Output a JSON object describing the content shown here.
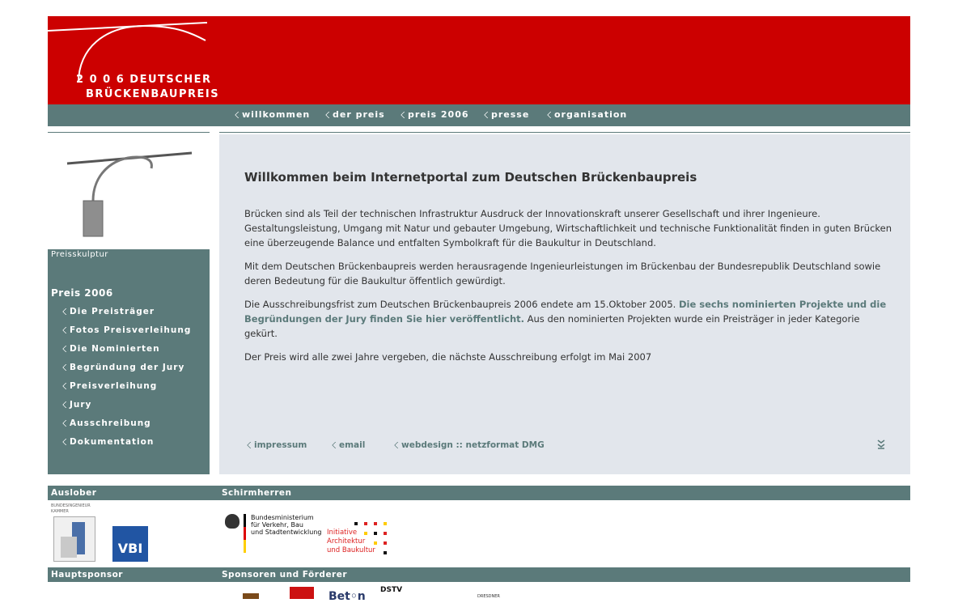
{
  "header": {
    "logo_line1": "2 0 0 6 DEUTSCHER",
    "logo_line2": "BRÜCKENBAUPREIS"
  },
  "nav": {
    "items": [
      "willkommen",
      "der preis",
      "preis 2006",
      "presse",
      "organisation"
    ]
  },
  "sidebar": {
    "caption": "Preisskulptur",
    "section_title": "Preis 2006",
    "items": [
      "Die Preisträger",
      "Fotos Preisverleihung",
      "Die Nominierten",
      "Begründung der Jury",
      "Preisverleihung",
      "Jury",
      "Ausschreibung",
      "Dokumentation"
    ]
  },
  "content": {
    "title": "Willkommen beim Internetportal zum Deutschen Brückenbaupreis",
    "p1": "Brücken sind als Teil der technischen Infrastruktur Ausdruck der Innovationskraft unserer Gesellschaft und ihrer Ingenieure. Gestaltungsleistung, Umgang mit Natur und gebauter Umgebung, Wirtschaftlichkeit und technische Funktionalität finden in guten Brücken eine überzeugende Balance und entfalten Symbolkraft für die Baukultur in Deutschland.",
    "p2": "Mit dem Deutschen Brückenbaupreis werden herausragende Ingenieurleistungen im Brückenbau der Bundesrepublik Deutschland sowie deren Bedeutung für die Baukultur öffentlich gewürdigt.",
    "p3_before": "Die Ausschreibungsfrist zum Deutschen Brückenbaupreis 2006 endete am 15.Oktober 2005. ",
    "p3_link": "Die sechs nominierten Projekte und die Begründungen der Jury finden Sie hier veröffentlicht.",
    "p3_after": " Aus den nominierten Projekten wurde ein Preisträger in jeder Kategorie gekürt.",
    "p4": "Der Preis wird alle zwei Jahre vergeben, die nächste Ausschreibung erfolgt im Mai 2007"
  },
  "footer_links": [
    "impressum",
    "email",
    "webdesign :: netzformat DMG"
  ],
  "bars": {
    "ausl": "Auslober",
    "schirm": "Schirmherren",
    "haupt": "Hauptsponsor",
    "spons": "Sponsoren und Förderer"
  },
  "logos": {
    "bik_caption_1": "BUNDESINGENIEUR",
    "bik_caption_2": "KAMMER",
    "vbi": "VBI",
    "bmvbs_1": "Bundesministerium",
    "bmvbs_2": "für Verkehr, Bau",
    "bmvbs_3": "und Stadtentwicklung",
    "iab_1": "Initiative",
    "iab_2": "Architektur",
    "iab_3": "und Baukultur",
    "dstv": "DSTV",
    "beton": "Bet◦n",
    "dresdner": "DRESDNER"
  },
  "colors": {
    "brand_red": "#cc0000",
    "teal": "#5b7a7a",
    "content_bg": "#e2e6ec"
  }
}
